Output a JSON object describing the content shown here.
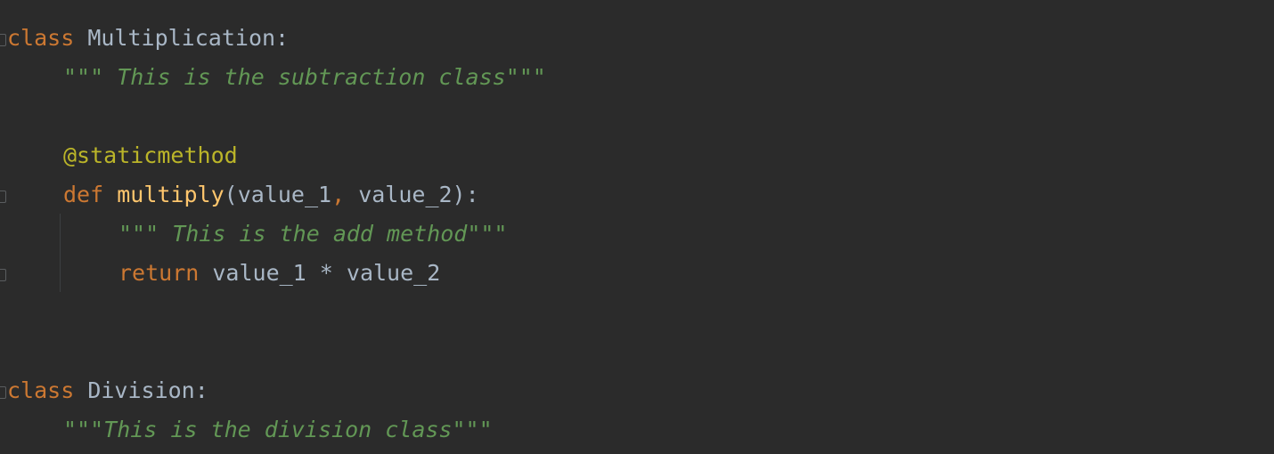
{
  "colors": {
    "background": "#2b2b2b",
    "keyword": "#cc7832",
    "identifier": "#a9b7c6",
    "docstring": "#629755",
    "decorator": "#bbb529",
    "function_name": "#ffc66d"
  },
  "icons": {
    "fold_marker": "fold-marker-icon"
  },
  "code": {
    "line1": {
      "kw": "class",
      "name": "Multiplication",
      "colon": ":"
    },
    "line2": {
      "doc": "\"\"\" This is the subtraction class\"\"\""
    },
    "line3": {
      "decorator": "@staticmethod"
    },
    "line4": {
      "kw": "def",
      "fn": "multiply",
      "open": "(",
      "arg1": "value_1",
      "comma": ",",
      "arg2": "value_2",
      "close": "):"
    },
    "line5": {
      "doc": "\"\"\" This is the add method\"\"\""
    },
    "line6": {
      "kw": "return",
      "expr": "value_1 * value_2"
    },
    "line7": {
      "kw": "class",
      "name": "Division",
      "colon": ":"
    },
    "line8": {
      "doc": "\"\"\"This is the division class\"\"\""
    }
  }
}
